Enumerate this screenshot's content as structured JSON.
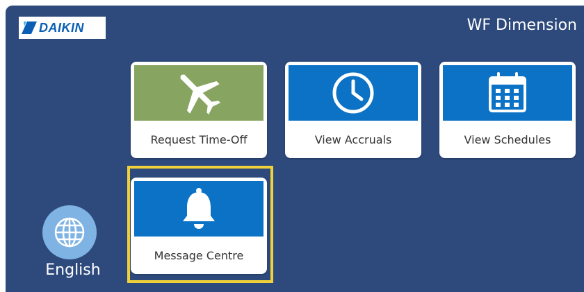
{
  "brand": {
    "logo_text": "DAIKIN",
    "logo_icon": "daikin-logo-icon"
  },
  "header": {
    "title": "WF Dimension"
  },
  "tiles": [
    {
      "label": "Request Time-Off",
      "icon": "airplane-icon",
      "color": "#87a460"
    },
    {
      "label": "View Accruals",
      "icon": "clock-icon",
      "color": "#0b72c6"
    },
    {
      "label": "View Schedules",
      "icon": "calendar-icon",
      "color": "#0b72c6"
    },
    {
      "label": "Message Centre",
      "icon": "bell-icon",
      "color": "#0b72c6",
      "selected": true
    }
  ],
  "language": {
    "label": "English",
    "icon": "globe-icon"
  },
  "colors": {
    "background": "#2e4a7d",
    "highlight": "#f1d13a",
    "globe": "#7fb3e3"
  }
}
